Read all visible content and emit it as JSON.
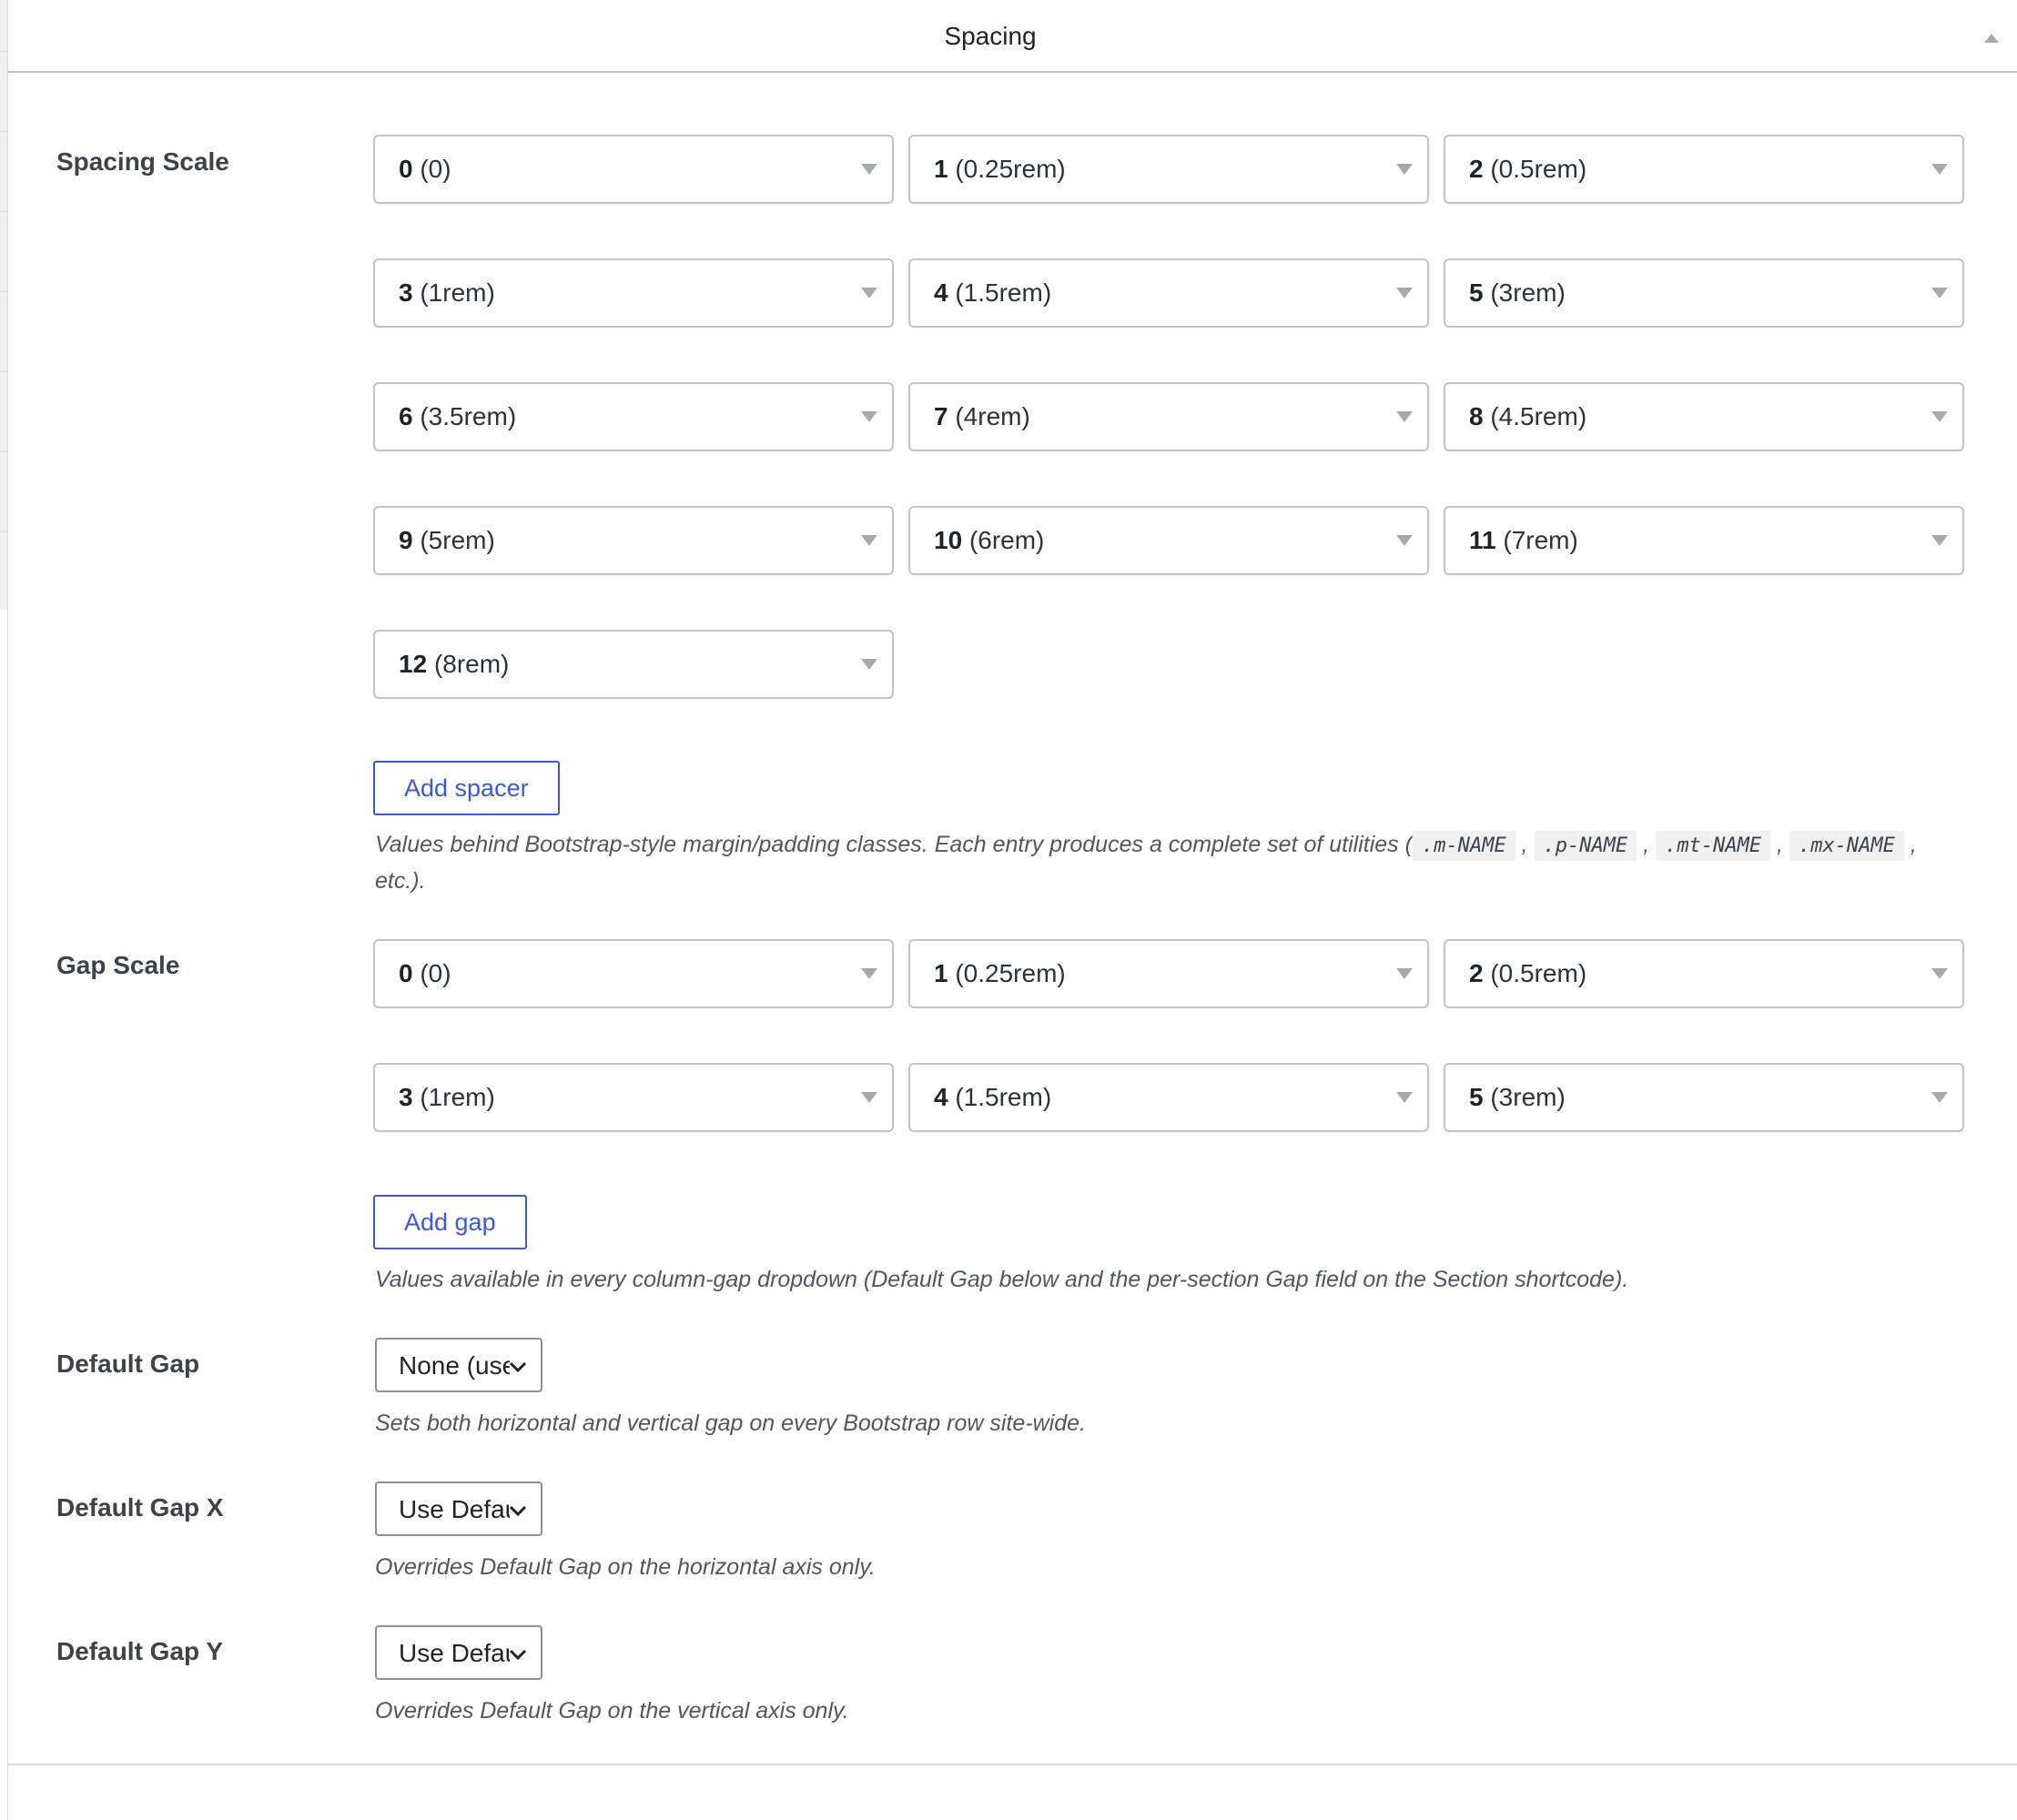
{
  "panel": {
    "title": "Spacing",
    "toggle_icon": "triangle-up-icon"
  },
  "spacing": {
    "label": "Spacing Scale",
    "items": [
      {
        "key": "0",
        "value": "(0)"
      },
      {
        "key": "1",
        "value": "(0.25rem)"
      },
      {
        "key": "2",
        "value": "(0.5rem)"
      },
      {
        "key": "3",
        "value": "(1rem)"
      },
      {
        "key": "4",
        "value": "(1.5rem)"
      },
      {
        "key": "5",
        "value": "(3rem)"
      },
      {
        "key": "6",
        "value": "(3.5rem)"
      },
      {
        "key": "7",
        "value": "(4rem)"
      },
      {
        "key": "8",
        "value": "(4.5rem)"
      },
      {
        "key": "9",
        "value": "(5rem)"
      },
      {
        "key": "10",
        "value": "(6rem)"
      },
      {
        "key": "11",
        "value": "(7rem)"
      },
      {
        "key": "12",
        "value": "(8rem)"
      }
    ],
    "add_label": "Add spacer",
    "desc_prefix": "Values behind Bootstrap-style margin/padding classes. Each entry produces a complete set of utilities (",
    "desc_codes": [
      ".m-NAME",
      ".p-NAME",
      ".mt-NAME",
      ".mx-NAME"
    ],
    "desc_sep": ",",
    "desc_suffix": "etc.)."
  },
  "gap": {
    "label": "Gap Scale",
    "items": [
      {
        "key": "0",
        "value": "(0)"
      },
      {
        "key": "1",
        "value": "(0.25rem)"
      },
      {
        "key": "2",
        "value": "(0.5rem)"
      },
      {
        "key": "3",
        "value": "(1rem)"
      },
      {
        "key": "4",
        "value": "(1.5rem)"
      },
      {
        "key": "5",
        "value": "(3rem)"
      }
    ],
    "add_label": "Add gap",
    "desc": "Values available in every column-gap dropdown (Default Gap below and the per-section Gap field on the Section shortcode)."
  },
  "default_gap": {
    "label": "Default Gap",
    "selected": "None (use",
    "desc": "Sets both horizontal and vertical gap on every Bootstrap row site-wide."
  },
  "default_gap_x": {
    "label": "Default Gap X",
    "selected": "Use Default",
    "desc": "Overrides Default Gap on the horizontal axis only."
  },
  "default_gap_y": {
    "label": "Default Gap Y",
    "selected": "Use Default",
    "desc": "Overrides Default Gap on the vertical axis only."
  }
}
